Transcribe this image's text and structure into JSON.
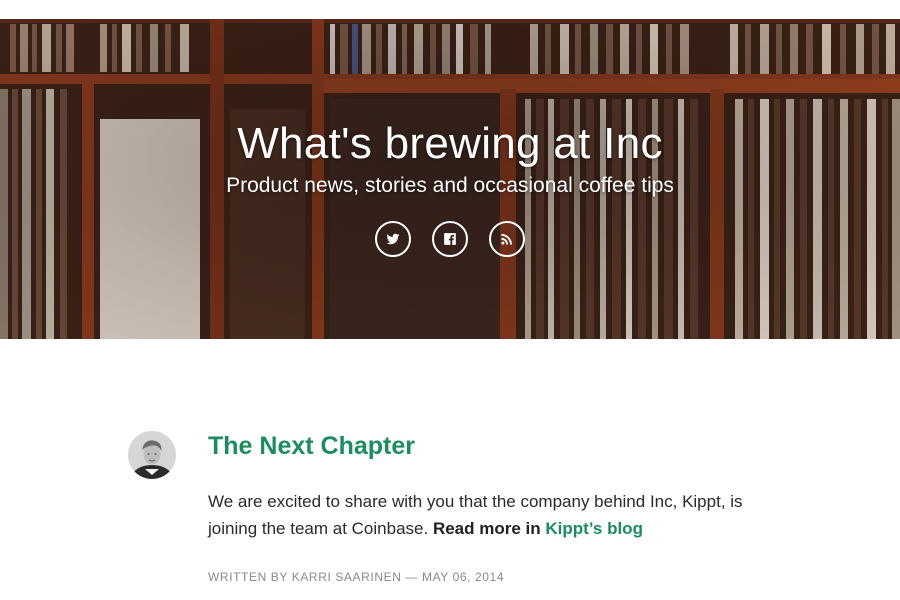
{
  "hero": {
    "title": "What's brewing at Inc",
    "subtitle": "Product news, stories and occasional coffee tips",
    "social": [
      {
        "icon": "twitter-icon"
      },
      {
        "icon": "facebook-icon"
      },
      {
        "icon": "rss-icon"
      }
    ]
  },
  "post": {
    "title": "The Next Chapter",
    "body_text": "We are excited to share with you that the company behind Inc, Kippt, is joining the team at Coinbase.",
    "read_more_prefix": "Read more in",
    "read_more_link": "Kippt’s blog",
    "byline_prefix": "Written by",
    "author": "Karri Saarinen",
    "separator": "—",
    "date": "May 06, 2014"
  },
  "colors": {
    "accent": "#1a8e5f",
    "text": "#2a2a2a",
    "muted": "#8a8a8a"
  }
}
